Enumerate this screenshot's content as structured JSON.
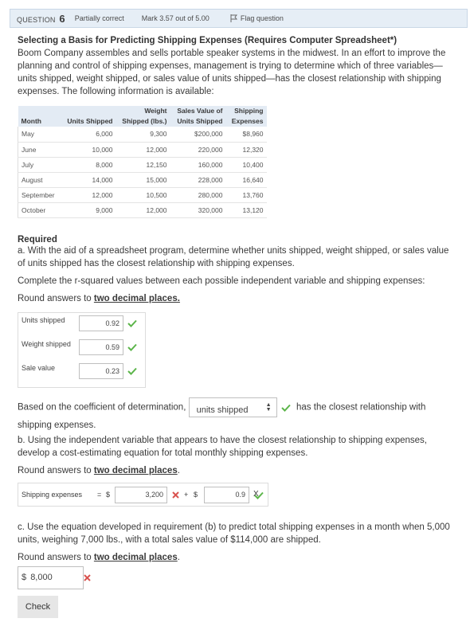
{
  "header": {
    "question_prefix": "QUESTION",
    "question_number": "6",
    "status": "Partially correct",
    "mark": "Mark 3.57 out of 5.00",
    "flag_label": "Flag question"
  },
  "problem": {
    "title": "Selecting a Basis for Predicting Shipping Expenses (Requires Computer Spreadsheet*)",
    "intro": "Boom Company assembles and sells portable speaker systems in the midwest. In an effort to improve the planning and control of shipping expenses, management is trying to determine which of three variables—units shipped, weight shipped, or sales value of units shipped—has the closest relationship with shipping expenses. The following information is available:"
  },
  "table": {
    "headers": {
      "month": "Month",
      "units": "Units Shipped",
      "weight_top": "Weight",
      "weight_bottom": "Shipped (lbs.)",
      "sales_top": "Sales Value of",
      "sales_bottom": "Units Shipped",
      "ship_top": "Shipping",
      "ship_bottom": "Expenses"
    },
    "rows": [
      {
        "month": "May",
        "units": "6,000",
        "weight": "9,300",
        "sales": "$200,000",
        "expenses": "$8,960"
      },
      {
        "month": "June",
        "units": "10,000",
        "weight": "12,000",
        "sales": "220,000",
        "expenses": "12,320"
      },
      {
        "month": "July",
        "units": "8,000",
        "weight": "12,150",
        "sales": "160,000",
        "expenses": "10,400"
      },
      {
        "month": "August",
        "units": "14,000",
        "weight": "15,000",
        "sales": "228,000",
        "expenses": "16,640"
      },
      {
        "month": "September",
        "units": "12,000",
        "weight": "10,500",
        "sales": "280,000",
        "expenses": "13,760"
      },
      {
        "month": "October",
        "units": "9,000",
        "weight": "12,000",
        "sales": "320,000",
        "expenses": "13,120"
      }
    ]
  },
  "required": {
    "heading": "Required",
    "part_a": "a. With the aid of a spreadsheet program, determine whether units shipped, weight shipped, or sales value of units shipped has the closest relationship with shipping expenses.",
    "instruction": "Complete the r-squared values between each possible independent variable and shipping expenses:",
    "round_prefix": "Round answers to ",
    "round_emph": "two decimal places."
  },
  "rsquared": {
    "units_label": "Units shipped",
    "units_value": "0.92",
    "weight_label": "Weight shipped",
    "weight_value": "0.59",
    "sales_label": "Sale value",
    "sales_value": "0.23"
  },
  "coefficient": {
    "prefix": "Based on the coefficient of determination,",
    "selected": "units shipped",
    "suffix": "has the closest relationship with shipping expenses."
  },
  "part_b": {
    "text": "b. Using the independent variable that appears to have the closest relationship to shipping expenses, develop a cost-estimating equation for total monthly shipping expenses.",
    "round_prefix": "Round answers to ",
    "round_emph": "two decimal places",
    "round_suffix": ".",
    "eq_label": "Shipping expenses",
    "equals": "=",
    "dollar1": "$",
    "fixed_value": "3,200",
    "plus": "+",
    "dollar2": "$",
    "variable_value": "0.9",
    "times": "X"
  },
  "part_c": {
    "text": "c. Use the equation developed in requirement (b) to predict total shipping expenses in a month when 5,000 units, weighing 7,000 lbs., with a total sales value of $114,000 are shipped.",
    "round_prefix": "Round answers to ",
    "round_emph": "two decimal places",
    "round_suffix": ".",
    "dollar": "$",
    "answer": "8,000"
  },
  "check_button": "Check",
  "colors": {
    "correct": "#5cb54a",
    "incorrect": "#d9534f",
    "header_bg": "#e6eef6",
    "table_header_bg": "#e3ebf4"
  }
}
